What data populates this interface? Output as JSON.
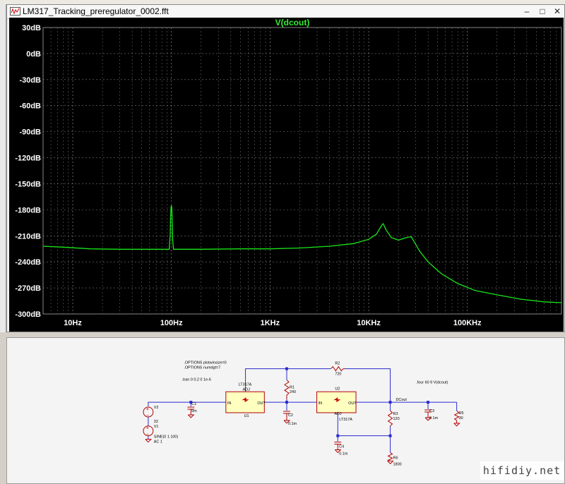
{
  "plot_window": {
    "title": "LM317_Tracking_preregulator_0002.fft",
    "minimize": "–",
    "maximize": "□",
    "close": "✕"
  },
  "chart_data": {
    "type": "line",
    "title": "V(dcout)",
    "x_scale": "log",
    "xlim": [
      5,
      900000
    ],
    "ylim": [
      -300,
      30
    ],
    "x_ticks": [
      10,
      100,
      1000,
      10000,
      100000
    ],
    "x_tick_labels": [
      "10Hz",
      "100Hz",
      "1KHz",
      "10KHz",
      "100KHz"
    ],
    "y_ticks": [
      30,
      0,
      -30,
      -60,
      -90,
      -120,
      -150,
      -180,
      -210,
      -240,
      -270,
      -300
    ],
    "y_tick_labels": [
      "30dB",
      "0dB",
      "-30dB",
      "-60dB",
      "-90dB",
      "-120dB",
      "-150dB",
      "-180dB",
      "-210dB",
      "-240dB",
      "-270dB",
      "-300dB"
    ],
    "grid": true,
    "series": [
      {
        "x": [
          5,
          8,
          15,
          30,
          60,
          95,
          97,
          98,
          99,
          100,
          101,
          102,
          103,
          105,
          107,
          200,
          500,
          1000,
          2000,
          4000,
          7000,
          10000,
          12000,
          13500,
          14000,
          15000,
          17000,
          20000,
          24000,
          27000,
          29000,
          33000,
          40000,
          55000,
          80000,
          120000,
          200000,
          350000,
          600000,
          900000
        ],
        "y": [
          -222,
          -223,
          -225,
          -225.5,
          -225.5,
          -225.5,
          -210,
          -190,
          -178,
          -175,
          -178,
          -195,
          -215,
          -225.5,
          -225.5,
          -225.5,
          -225,
          -225,
          -224,
          -222,
          -219,
          -214,
          -208,
          -198,
          -196,
          -203,
          -212,
          -215,
          -212,
          -211,
          -217,
          -228,
          -240,
          -254,
          -265,
          -273,
          -278,
          -283,
          -286,
          -287
        ]
      }
    ]
  },
  "schematic": {
    "options1": ".OPTIONS plotwinsize=0",
    "options2": ".OPTIONS numdgt=7",
    "tran": ".tran 0 0.2 0 1e-6",
    "four": ".four 60 9 V(dcout)",
    "v2": "V2",
    "v2_val": "32",
    "v1": "V1",
    "v1_val1": "SINE(0 1 100)",
    "v1_val2": "AC 1",
    "c1": "C1",
    "c1_val": "5m",
    "u1": "U1",
    "u1_part": "LT317A",
    "u2": "U2",
    "u2_part": "LT317A",
    "pin_in": "IN",
    "pin_out": "OUT",
    "pin_adj": "ADJ",
    "r1": "R1",
    "r1_val": "240",
    "r2": "R2",
    "r2_val": "720",
    "c2": "C2",
    "c2_val": "0.1m",
    "r3": "R3",
    "r3_val": "120",
    "c4": "C4",
    "c4_val": "0.1m",
    "r6": "R6",
    "r6_val": "1800",
    "dcout": "DCout",
    "c3": "C3",
    "c3_val": "0.1m",
    "r5": "R5",
    "r5_val": "30"
  },
  "watermark": "hifidiy.net"
}
